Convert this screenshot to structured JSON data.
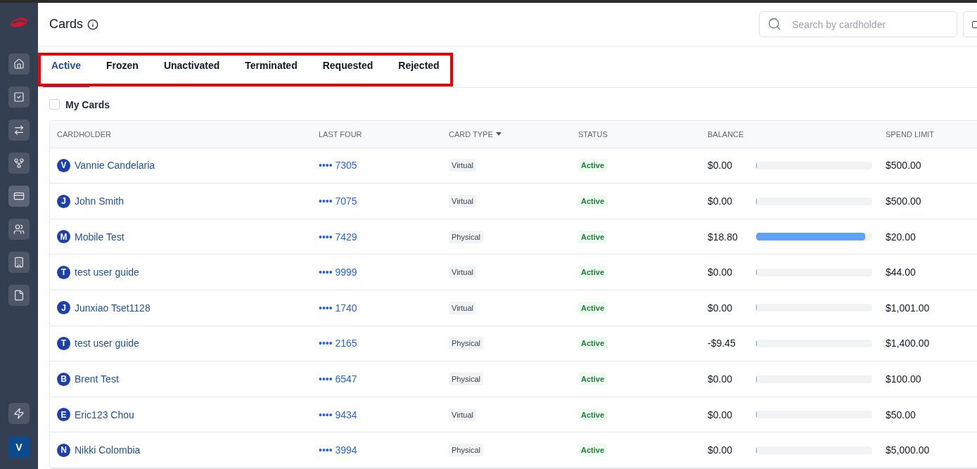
{
  "sidebar": {
    "items": [
      {
        "selected": false
      },
      {
        "selected": false
      },
      {
        "selected": false
      },
      {
        "selected": false
      },
      {
        "selected": true
      },
      {
        "selected": false
      },
      {
        "selected": false
      },
      {
        "selected": false
      }
    ],
    "bottom_items": [
      {
        "selected": false
      }
    ],
    "avatar": "V"
  },
  "header": {
    "title": "Cards",
    "search": {
      "placeholder": "Search by cardholder"
    }
  },
  "tabs": [
    {
      "label": "Active",
      "selected": true
    },
    {
      "label": "Frozen",
      "selected": false
    },
    {
      "label": "Unactivated",
      "selected": false
    },
    {
      "label": "Terminated",
      "selected": false
    },
    {
      "label": "Requested",
      "selected": false
    },
    {
      "label": "Rejected",
      "selected": false
    }
  ],
  "tabs_highlighted": true,
  "filter": {
    "label": "My Cards",
    "checked": false
  },
  "table": {
    "columns": [
      "CARDHOLDER",
      "LAST FOUR",
      "CARD TYPE",
      "STATUS",
      "BALANCE",
      "SPEND LIMIT"
    ],
    "rows": [
      {
        "initial": "V",
        "cardholder": "Vannie Candelaria",
        "last_four": "•••• 7305",
        "card_type": "Virtual",
        "status": "Active",
        "balance": "$0.00",
        "level": 0,
        "spend_limit": "$500.00"
      },
      {
        "initial": "J",
        "cardholder": "John Smith",
        "last_four": "•••• 7075",
        "card_type": "Virtual",
        "status": "Active",
        "balance": "$0.00",
        "level": 0,
        "spend_limit": "$500.00"
      },
      {
        "initial": "M",
        "cardholder": "Mobile Test",
        "last_four": "•••• 7429",
        "card_type": "Physical",
        "status": "Active",
        "balance": "$18.80",
        "level": 0.94,
        "spend_limit": "$20.00"
      },
      {
        "initial": "T",
        "cardholder": "test user guide",
        "last_four": "•••• 9999",
        "card_type": "Virtual",
        "status": "Active",
        "balance": "$0.00",
        "level": 0,
        "spend_limit": "$44.00"
      },
      {
        "initial": "J",
        "cardholder": "Junxiao Tset1128",
        "last_four": "•••• 1740",
        "card_type": "Virtual",
        "status": "Active",
        "balance": "$0.00",
        "level": 0,
        "spend_limit": "$1,001.00"
      },
      {
        "initial": "T",
        "cardholder": "test user guide",
        "last_four": "•••• 2165",
        "card_type": "Physical",
        "status": "Active",
        "balance": "-$9.45",
        "level": 0,
        "spend_limit": "$1,400.00"
      },
      {
        "initial": "B",
        "cardholder": "Brent Test",
        "last_four": "•••• 6547",
        "card_type": "Physical",
        "status": "Active",
        "balance": "$0.00",
        "level": 0,
        "spend_limit": "$100.00"
      },
      {
        "initial": "E",
        "cardholder": "Eric123 Chou",
        "last_four": "•••• 9434",
        "card_type": "Virtual",
        "status": "Active",
        "balance": "$0.00",
        "level": 0,
        "spend_limit": "$50.00"
      },
      {
        "initial": "N",
        "cardholder": "Nikki Colombia",
        "last_four": "•••• 3994",
        "card_type": "Physical",
        "status": "Active",
        "balance": "$0.00",
        "level": 0,
        "spend_limit": "$5,000.00"
      }
    ]
  }
}
